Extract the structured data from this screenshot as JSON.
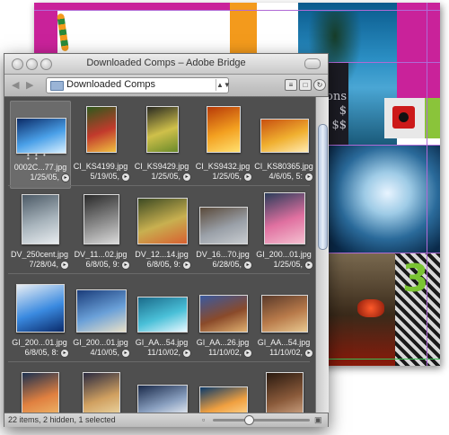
{
  "window": {
    "title": "Downloaded Comps – Adobe Bridge",
    "path_label": "Downloaded Comps",
    "status": "22 items, 2 hidden, 1 selected",
    "zoom_level": 0.35
  },
  "background_doc": {
    "text_lines": [
      "ons",
      "$",
      "$$"
    ]
  },
  "thumbnails": [
    {
      "name": "0002C...77.jpg",
      "date": "1/25/05,",
      "selected": true,
      "dots": "• • • • •",
      "colors": [
        "#0b2a66",
        "#4aa0e8",
        "#d8f0ff"
      ],
      "w": 54,
      "h": 38
    },
    {
      "name": "CI_KS4199.jpg",
      "date": "5/19/05,",
      "selected": false,
      "colors": [
        "#2e5a1c",
        "#c23a2c",
        "#f0c040"
      ],
      "w": 32,
      "h": 50
    },
    {
      "name": "CI_KS9429.jpg",
      "date": "1/25/05,",
      "selected": false,
      "colors": [
        "#2a2a22",
        "#cfc04a",
        "#6a8a2a"
      ],
      "w": 34,
      "h": 50
    },
    {
      "name": "CI_KS9432.jpg",
      "date": "1/25/05,",
      "selected": false,
      "colors": [
        "#b83a08",
        "#f3a020",
        "#ffe070"
      ],
      "w": 36,
      "h": 50
    },
    {
      "name": "CI_KS80365.jpg",
      "date": "4/6/05, 5:",
      "selected": false,
      "colors": [
        "#c85010",
        "#f0b030",
        "#ffeab0"
      ],
      "w": 52,
      "h": 36
    },
    {
      "name": "DV_250cent.jpg",
      "date": "7/28/04,",
      "selected": false,
      "colors": [
        "#4c5a66",
        "#a8b4bc",
        "#e8ecef"
      ],
      "w": 40,
      "h": 54
    },
    {
      "name": "DV_11...02.jpg",
      "date": "6/8/05, 9:",
      "selected": false,
      "colors": [
        "#2a2a2a",
        "#8a8a8a",
        "#dadada"
      ],
      "w": 38,
      "h": 54
    },
    {
      "name": "DV_12...14.jpg",
      "date": "6/8/05, 9:",
      "selected": false,
      "colors": [
        "#3c4a22",
        "#c8b050",
        "#d86030"
      ],
      "w": 54,
      "h": 50
    },
    {
      "name": "DV_16...70.jpg",
      "date": "6/28/05,",
      "selected": false,
      "colors": [
        "#5a4a3a",
        "#9aa0a8",
        "#c8ccd0"
      ],
      "w": 52,
      "h": 40
    },
    {
      "name": "GI_200...01.jpg",
      "date": "1/25/05,",
      "selected": false,
      "colors": [
        "#2a3c5a",
        "#e070a0",
        "#f4c0d0"
      ],
      "w": 44,
      "h": 56
    },
    {
      "name": "GI_200...01.jpg",
      "date": "6/8/05, 8:",
      "selected": false,
      "colors": [
        "#e8eef4",
        "#3a8ae0",
        "#0a2a6a"
      ],
      "w": 52,
      "h": 52
    },
    {
      "name": "GI_200...01.jpg",
      "date": "4/10/05,",
      "selected": false,
      "colors": [
        "#1a3c7a",
        "#6aa0d8",
        "#e8e0c8"
      ],
      "w": 54,
      "h": 46
    },
    {
      "name": "GI_AA...54.jpg",
      "date": "11/10/02,",
      "selected": false,
      "colors": [
        "#1a6a8a",
        "#4ac0d8",
        "#e8f8ff"
      ],
      "w": 54,
      "h": 38
    },
    {
      "name": "GI_AA...26.jpg",
      "date": "11/10/02,",
      "selected": false,
      "colors": [
        "#3a5aa0",
        "#8a4a2a",
        "#e0b070"
      ],
      "w": 52,
      "h": 40
    },
    {
      "name": "GI_AA...54.jpg",
      "date": "11/10/02,",
      "selected": false,
      "colors": [
        "#5a3a2a",
        "#b87a4a",
        "#e8c890"
      ],
      "w": 50,
      "h": 40
    },
    {
      "name": "",
      "date": "",
      "selected": false,
      "colors": [
        "#1a3050",
        "#e08040",
        "#f0c070"
      ],
      "w": 40,
      "h": 52
    },
    {
      "name": "",
      "date": "",
      "selected": false,
      "colors": [
        "#2a2a40",
        "#d0a060",
        "#f0e0b0"
      ],
      "w": 40,
      "h": 52
    },
    {
      "name": "",
      "date": "",
      "selected": false,
      "colors": [
        "#1a2a4a",
        "#8aa0c0",
        "#ffffff"
      ],
      "w": 54,
      "h": 38
    },
    {
      "name": "",
      "date": "",
      "selected": false,
      "colors": [
        "#0a3a6a",
        "#f0a040",
        "#ffe0a0"
      ],
      "w": 52,
      "h": 36
    },
    {
      "name": "",
      "date": "",
      "selected": false,
      "colors": [
        "#2a1a10",
        "#8a5a3a",
        "#d8b090"
      ],
      "w": 40,
      "h": 52
    }
  ]
}
